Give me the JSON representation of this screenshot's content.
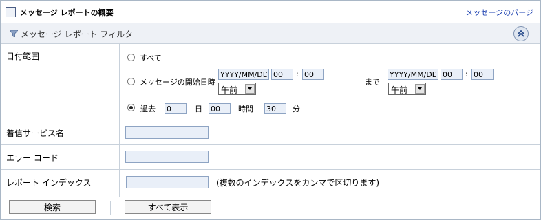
{
  "header": {
    "title": "メッセージ レポートの概要",
    "link": "メッセージのパージ"
  },
  "filter": {
    "label": "メッセージ レポート フィルタ"
  },
  "date_range": {
    "label": "日付範囲",
    "all_label": "すべて",
    "start_label": "メッセージの開始日時",
    "start_date": "YYYY/MM/DD",
    "start_hour": "00",
    "start_min": "00",
    "start_ampm": "午前",
    "until_label": "まで",
    "end_date": "YYYY/MM/DD",
    "end_hour": "00",
    "end_min": "00",
    "end_ampm": "午前",
    "colon": ":",
    "past_label": "過去",
    "days_value": "0",
    "days_unit": "日",
    "hours_value": "00",
    "hours_unit": "時間",
    "minutes_value": "30",
    "minutes_unit": "分",
    "selected": "past"
  },
  "service": {
    "label": "着信サービス名",
    "value": ""
  },
  "error_code": {
    "label": "エラー コード",
    "value": ""
  },
  "report_index": {
    "label": "レポート インデックス",
    "value": "",
    "hint": "(複数のインデックスをカンマで区切ります)"
  },
  "buttons": {
    "search": "検索",
    "show_all": "すべて表示"
  }
}
